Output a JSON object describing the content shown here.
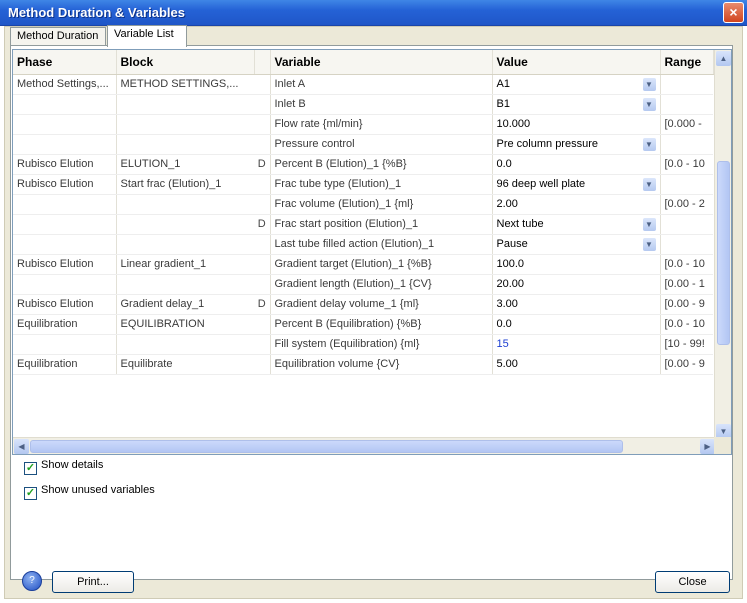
{
  "window": {
    "title": "Method Duration & Variables",
    "close_glyph": "×"
  },
  "tabs": [
    {
      "label": "Method Duration"
    },
    {
      "label": "Variable List"
    }
  ],
  "grid": {
    "columns": [
      "Phase",
      "Block",
      "",
      "Variable",
      "Value",
      "Range"
    ],
    "rows": [
      {
        "phase": "Method Settings,...",
        "block": "METHOD SETTINGS,...",
        "flag": "",
        "variable": "Inlet A",
        "value": "A1",
        "range": "",
        "dropdown": true
      },
      {
        "phase": "",
        "block": "",
        "flag": "",
        "variable": "Inlet B",
        "value": "B1",
        "range": "",
        "dropdown": true
      },
      {
        "phase": "",
        "block": "",
        "flag": "",
        "variable": "Flow rate {ml/min}",
        "value": "10.000",
        "range": "[0.000 -",
        "dropdown": false
      },
      {
        "phase": "",
        "block": "",
        "flag": "",
        "variable": "Pressure control",
        "value": "Pre column pressure",
        "range": "",
        "dropdown": true
      },
      {
        "phase": "Rubisco Elution",
        "block": "ELUTION_1",
        "flag": "D",
        "variable": "Percent B (Elution)_1 {%B}",
        "value": "0.0",
        "range": "[0.0 - 10",
        "dropdown": false
      },
      {
        "phase": "Rubisco Elution",
        "block": "Start frac (Elution)_1",
        "flag": "",
        "variable": "Frac tube type (Elution)_1",
        "value": "96 deep well plate",
        "range": "",
        "dropdown": true
      },
      {
        "phase": "",
        "block": "",
        "flag": "",
        "variable": "Frac volume (Elution)_1 {ml}",
        "value": "2.00",
        "range": "[0.00 - 2",
        "dropdown": false
      },
      {
        "phase": "",
        "block": "",
        "flag": "D",
        "variable": "Frac start position (Elution)_1",
        "value": "Next tube",
        "range": "",
        "dropdown": true
      },
      {
        "phase": "",
        "block": "",
        "flag": "",
        "variable": "Last tube filled action (Elution)_1",
        "value": "Pause",
        "range": "",
        "dropdown": true
      },
      {
        "phase": "Rubisco Elution",
        "block": "Linear gradient_1",
        "flag": "",
        "variable": "Gradient target (Elution)_1 {%B}",
        "value": "100.0",
        "range": "[0.0 - 10",
        "dropdown": false
      },
      {
        "phase": "",
        "block": "",
        "flag": "",
        "variable": "Gradient length (Elution)_1 {CV}",
        "value": "20.00",
        "range": "[0.00 - 1",
        "dropdown": false
      },
      {
        "phase": "Rubisco Elution",
        "block": "Gradient delay_1",
        "flag": "D",
        "variable": "Gradient delay volume_1 {ml}",
        "value": "3.00",
        "range": "[0.00 - 9",
        "dropdown": false
      },
      {
        "phase": "Equilibration",
        "block": "EQUILIBRATION",
        "flag": "",
        "variable": "Percent B (Equilibration) {%B}",
        "value": "0.0",
        "range": "[0.0 - 10",
        "dropdown": false
      },
      {
        "phase": "",
        "block": "",
        "flag": "",
        "variable": "Fill system (Equilibration) {ml}",
        "value": "15",
        "range": "[10 - 99!",
        "dropdown": false,
        "value_color": "#1d3fd1"
      },
      {
        "phase": "Equilibration",
        "block": "Equilibrate",
        "flag": "",
        "variable": "Equilibration volume {CV}",
        "value": "5.00",
        "range": "[0.00 - 9",
        "dropdown": false
      }
    ]
  },
  "options": {
    "show_details": {
      "label": "Show details",
      "checked": true
    },
    "show_unused": {
      "label": "Show unused variables",
      "checked": true
    }
  },
  "buttons": {
    "print": "Print...",
    "close": "Close",
    "help_glyph": "?"
  },
  "icons": {
    "dropdown": "chevron-down-icon",
    "help": "help-icon",
    "close": "close-icon"
  }
}
